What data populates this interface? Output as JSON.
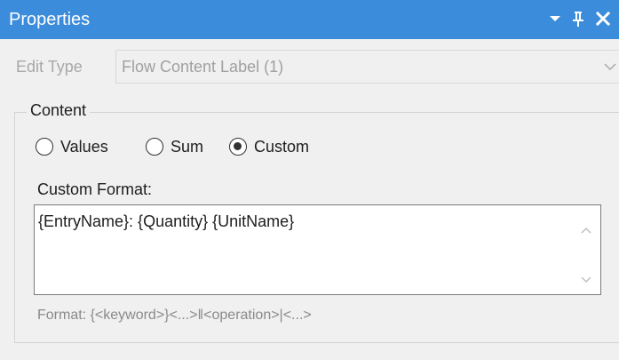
{
  "panel": {
    "title": "Properties",
    "buttons": {
      "dropdown_icon": "chevron-down-icon",
      "pin_icon": "pin-icon",
      "close_icon": "close-icon"
    }
  },
  "edit_type": {
    "label": "Edit Type",
    "value": "Flow Content Label (1)"
  },
  "content": {
    "legend": "Content",
    "options": [
      {
        "label": "Values",
        "checked": false
      },
      {
        "label": "Sum",
        "checked": false
      },
      {
        "label": "Custom",
        "checked": true
      }
    ],
    "custom_format_label": "Custom Format:",
    "custom_format_value": "{EntryName}: {Quantity} {UnitName}",
    "format_hint": "Format: {<keyword>}<...>‖<operation>|<...>"
  },
  "colors": {
    "titlebar": "#3c8cdc",
    "background": "#f0f0f0",
    "disabled_text": "#a0a0a0",
    "hint_text": "#8a8a8a"
  }
}
